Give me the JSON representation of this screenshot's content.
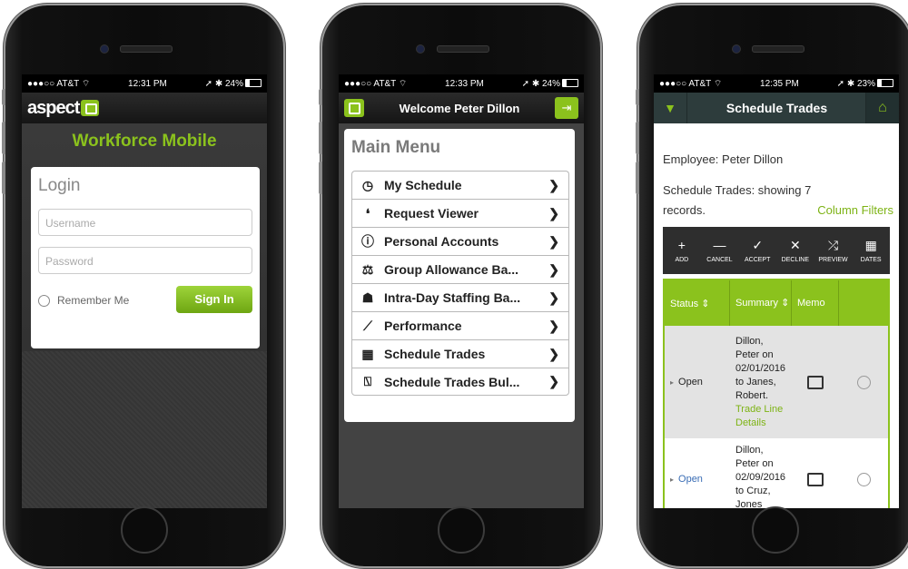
{
  "phone1": {
    "status": {
      "carrier": "●●●○○ AT&T ⌔",
      "time": "12:31 PM",
      "battery": "➚ ✱ 24%"
    },
    "brand": "aspect",
    "title": "Workforce Mobile",
    "login": {
      "heading": "Login",
      "username_placeholder": "Username",
      "password_placeholder": "Password",
      "remember_label": "Remember Me",
      "signin_label": "Sign In"
    }
  },
  "phone2": {
    "status": {
      "carrier": "●●●○○ AT&T ⌔",
      "time": "12:33 PM",
      "battery": "➚ ✱ 24%"
    },
    "welcome": "Welcome Peter Dillon",
    "menu_title": "Main Menu",
    "menu_items": [
      {
        "label": "My Schedule",
        "icon": "clock-icon",
        "glyph": "◷"
      },
      {
        "label": "Request Viewer",
        "icon": "chat-bubbles-icon",
        "glyph": "❛"
      },
      {
        "label": "Personal Accounts",
        "icon": "info-icon",
        "glyph": "ⓘ"
      },
      {
        "label": "Group Allowance Ba...",
        "icon": "scales-icon",
        "glyph": "⚖"
      },
      {
        "label": "Intra-Day Staffing Ba...",
        "icon": "people-icon",
        "glyph": "☗"
      },
      {
        "label": "Performance",
        "icon": "line-chart-icon",
        "glyph": "⟋"
      },
      {
        "label": "Schedule Trades",
        "icon": "calendar-icon",
        "glyph": "▦"
      },
      {
        "label": "Schedule Trades Bul...",
        "icon": "presentation-icon",
        "glyph": "⍂"
      }
    ],
    "chevron": "❯"
  },
  "phone3": {
    "status": {
      "carrier": "●●●○○ AT&T ⌔",
      "time": "12:35 PM",
      "battery": "➚ ✱ 23%"
    },
    "header_title": "Schedule Trades",
    "employee": "Employee: Peter Dillon",
    "records_line1": "Schedule Trades: showing 7",
    "records_line2": "records.",
    "column_filters": "Column Filters",
    "toolbar": [
      {
        "glyph": "+",
        "label": "ADD"
      },
      {
        "glyph": "—",
        "label": "CANCEL"
      },
      {
        "glyph": "✓",
        "label": "ACCEPT"
      },
      {
        "glyph": "✕",
        "label": "DECLINE"
      },
      {
        "glyph": "⤮",
        "label": "PREVIEW"
      },
      {
        "glyph": "▦",
        "label": "DATES"
      }
    ],
    "columns": [
      "Status ⇕",
      "Summary ⇕",
      "Memo",
      ""
    ],
    "rows": [
      {
        "status": "Open",
        "summary": [
          "Dillon,",
          "Peter on",
          "02/01/2016",
          "to Janes,",
          "Robert."
        ],
        "link": [
          "Trade Line",
          "Details"
        ]
      },
      {
        "status": "Open",
        "summary": [
          "Dillon,",
          "Peter on",
          "02/09/2016",
          "to Cruz,",
          "Jones"
        ],
        "link": []
      }
    ]
  },
  "colors": {
    "accent": "#8bc21d",
    "dark": "#2d3c3c"
  }
}
